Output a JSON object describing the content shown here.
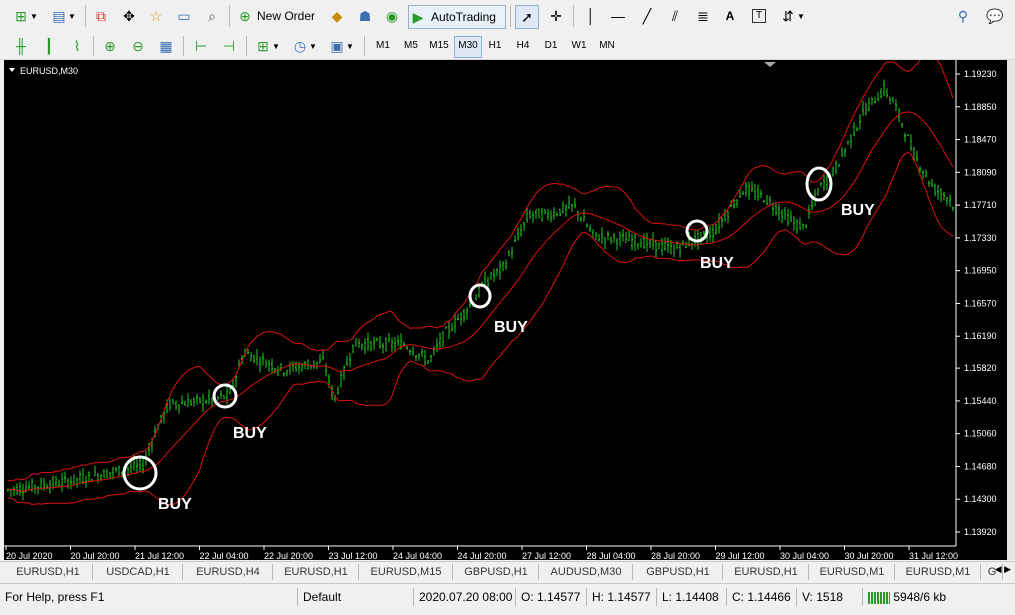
{
  "toolbar": {
    "new_order_label": "New Order",
    "autotrading_label": "AutoTrading",
    "text_tool_label": "A",
    "timeframes": [
      "M1",
      "M5",
      "M15",
      "M30",
      "H1",
      "H4",
      "D1",
      "W1",
      "MN"
    ],
    "active_timeframe": "M30"
  },
  "chart": {
    "symbol_label": "EURUSD,M30",
    "background": "#000000",
    "candle_color": "#22cc22",
    "band_color": "#dd1111",
    "price_labels": [
      "1.19230",
      "1.18850",
      "1.18470",
      "1.18090",
      "1.17710",
      "1.17330",
      "1.16950",
      "1.16570",
      "1.16190",
      "1.15820",
      "1.15440",
      "1.15060",
      "1.14680",
      "1.14300",
      "1.13920"
    ],
    "time_labels": [
      "20 Jul 2020",
      "20 Jul 20:00",
      "21 Jul 12:00",
      "22 Jul 04:00",
      "22 Jul 20:00",
      "23 Jul 12:00",
      "24 Jul 04:00",
      "24 Jul 20:00",
      "27 Jul 12:00",
      "28 Jul 04:00",
      "28 Jul 20:00",
      "29 Jul 12:00",
      "30 Jul 04:00",
      "30 Jul 20:00",
      "31 Jul 12:00"
    ],
    "annotations": [
      "BUY",
      "BUY",
      "BUY",
      "BUY",
      "BUY"
    ],
    "price_range": [
      1.1392,
      1.1923
    ]
  },
  "tabs": [
    "EURUSD,H1",
    "USDCAD,H1",
    "EURUSD,H4",
    "EURUSD,H1",
    "EURUSD,M15",
    "GBPUSD,H1",
    "AUDUSD,M30",
    "GBPUSD,H1",
    "EURUSD,H1",
    "EURUSD,M1",
    "EURUSD,M1",
    "G"
  ],
  "status": {
    "help": "For Help, press F1",
    "profile": "Default",
    "datetime": "2020.07.20 08:00",
    "open": "O: 1.14577",
    "high": "H: 1.14577",
    "low": "L: 1.14408",
    "close": "C: 1.14466",
    "volume": "V: 1518",
    "traffic": "5948/6 kb"
  }
}
